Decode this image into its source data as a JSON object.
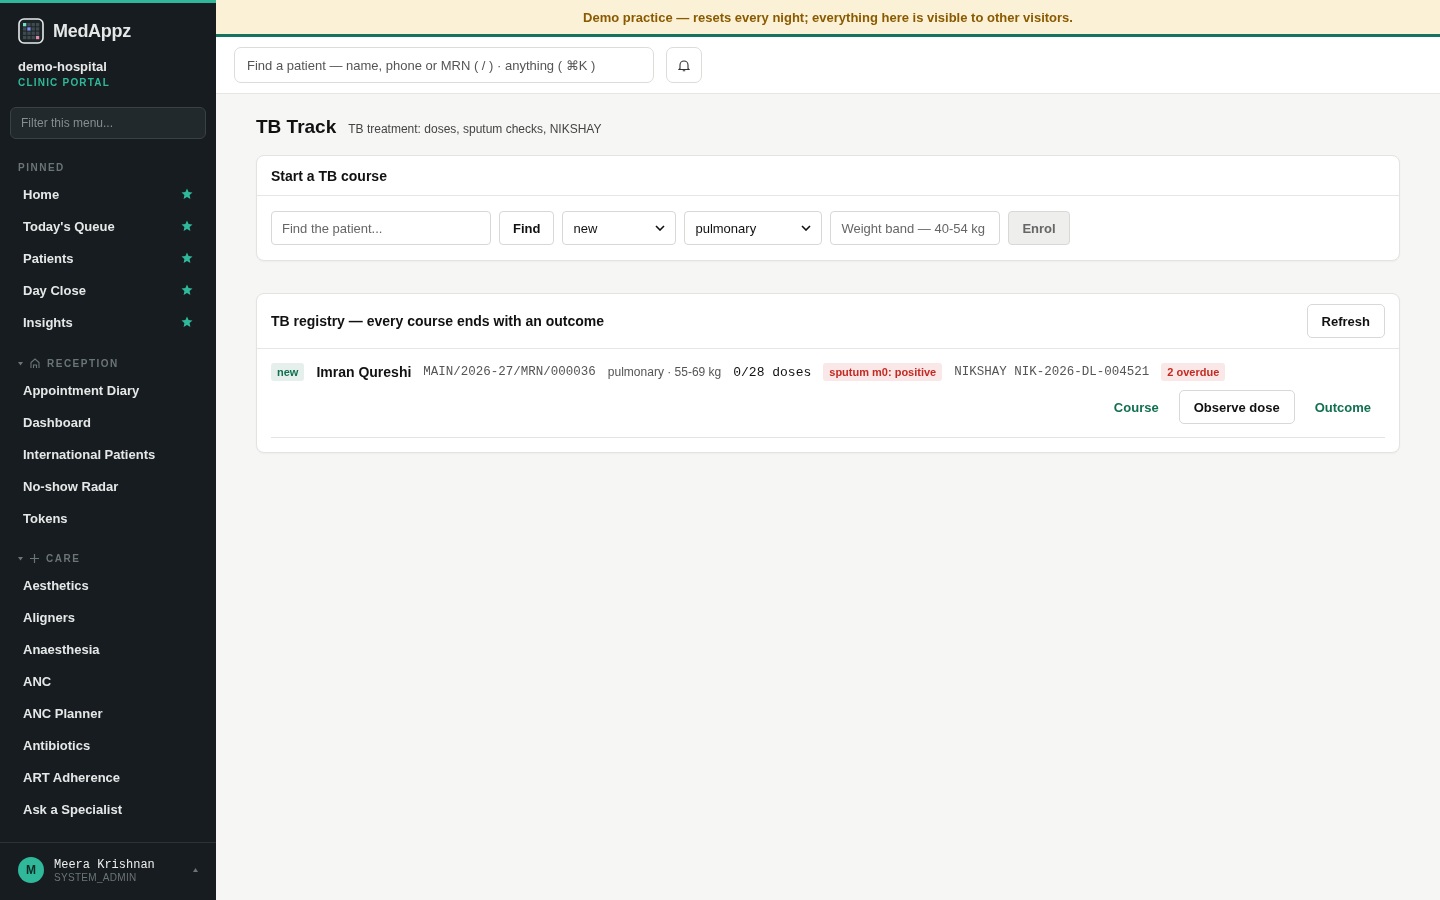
{
  "banner": "Demo practice — resets every night; everything here is visible to other visitors.",
  "sidebar": {
    "brand": "MedAppz",
    "org": "demo-hospital",
    "portal": "CLINIC PORTAL",
    "filter": {
      "placeholder": "Filter this menu..."
    },
    "sections": [
      {
        "title": "PINNED",
        "kind": "pinned",
        "items": [
          {
            "label": "Home",
            "pinned": true
          },
          {
            "label": "Today's Queue",
            "pinned": true
          },
          {
            "label": "Patients",
            "pinned": true
          },
          {
            "label": "Day Close",
            "pinned": true
          },
          {
            "label": "Insights",
            "pinned": true
          }
        ]
      },
      {
        "title": "RECEPTION",
        "kind": "reception",
        "expanded": true,
        "items": [
          {
            "label": "Appointment Diary",
            "pinned": false
          },
          {
            "label": "Dashboard",
            "pinned": false
          },
          {
            "label": "International Patients",
            "pinned": false
          },
          {
            "label": "No-show Radar",
            "pinned": false
          },
          {
            "label": "Tokens",
            "pinned": false
          }
        ]
      },
      {
        "title": "CARE",
        "kind": "care",
        "expanded": true,
        "items": [
          {
            "label": "Aesthetics",
            "pinned": false
          },
          {
            "label": "Aligners",
            "pinned": false
          },
          {
            "label": "Anaesthesia",
            "pinned": false
          },
          {
            "label": "ANC",
            "pinned": false
          },
          {
            "label": "ANC Planner",
            "pinned": false
          },
          {
            "label": "Antibiotics",
            "pinned": false
          },
          {
            "label": "ART Adherence",
            "pinned": false
          },
          {
            "label": "Ask a Specialist",
            "pinned": false
          }
        ]
      }
    ],
    "user": {
      "initial": "M",
      "name": "Meera Krishnan",
      "role": "SYSTEM_ADMIN"
    }
  },
  "search": {
    "placeholder": "Find a patient — name, phone or MRN ( / ) · anything ( ⌘K )"
  },
  "page": {
    "title": "TB Track",
    "subtitle": "TB treatment: doses, sputum checks, NIKSHAY"
  },
  "enrol": {
    "title": "Start a TB course",
    "patient": {
      "placeholder": "Find the patient..."
    },
    "find": "Find",
    "type": {
      "value": "new"
    },
    "site": {
      "value": "pulmonary"
    },
    "weight": {
      "placeholder": "Weight band — 40-54 kg"
    },
    "enrol": {
      "label": "Enrol",
      "disabled": true
    }
  },
  "registry": {
    "title": "TB registry — every course ends with an outcome",
    "refresh": "Refresh",
    "rows": [
      {
        "status": {
          "text": "new",
          "color": "#11704f"
        },
        "name": "Imran Qureshi",
        "mrn": "MAIN/2026-27/MRN/000036",
        "site_weight": "pulmonary · 55-69 kg",
        "doses": "0/28 doses",
        "sputum": {
          "text": "sputum m0: positive",
          "color": "#c42a22"
        },
        "nikshay": "NIKSHAY NIK-2026-DL-004521",
        "overdue": {
          "text": "2 overdue",
          "color": "#c42a22"
        },
        "actions": [
          {
            "label": "Course",
            "kind": "link"
          },
          {
            "label": "Observe dose",
            "kind": "button"
          },
          {
            "label": "Outcome",
            "kind": "link"
          }
        ]
      }
    ]
  }
}
